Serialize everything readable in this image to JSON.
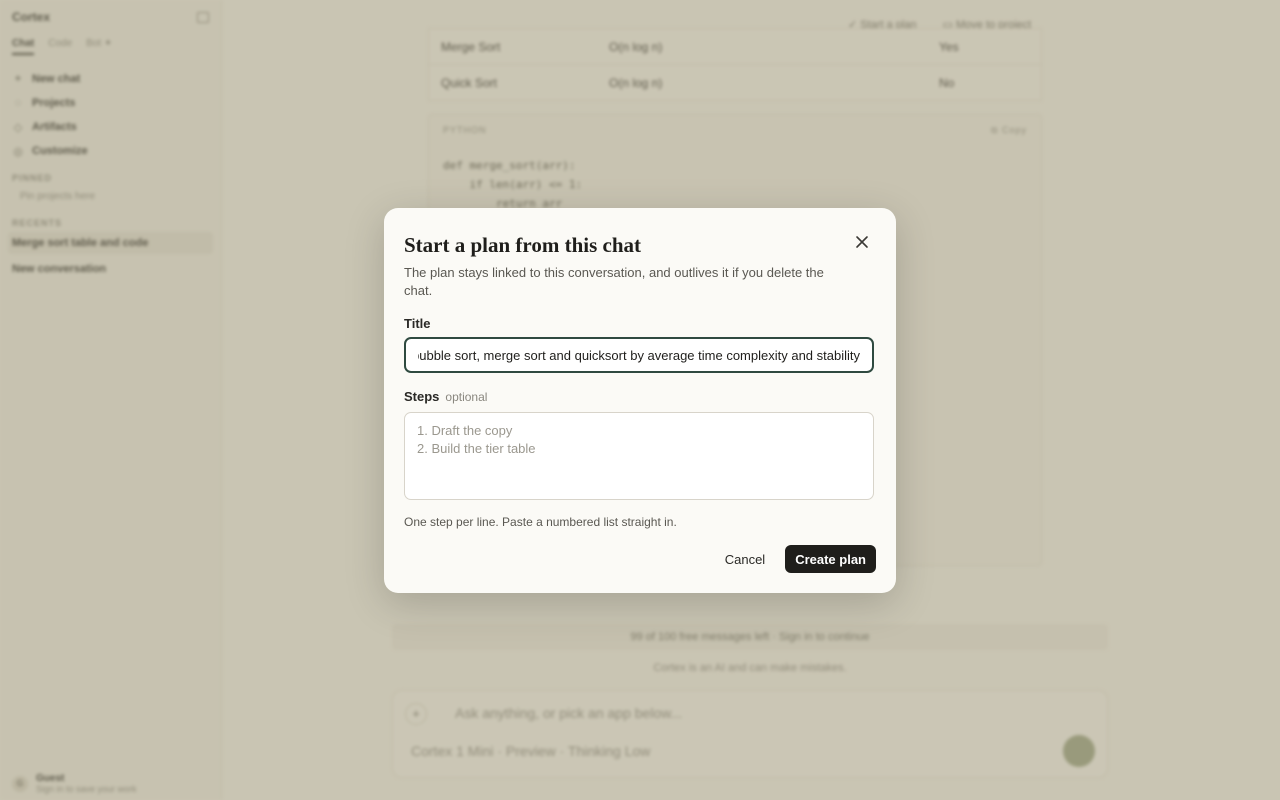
{
  "sidebar": {
    "brand": "Cortex",
    "tabs": [
      {
        "label": "Chat",
        "active": true
      },
      {
        "label": "Code",
        "active": false
      },
      {
        "label": "Bot ✦",
        "active": false
      }
    ],
    "nav": [
      {
        "icon": "plus-icon",
        "glyph": "+",
        "label": "New chat"
      },
      {
        "icon": "chat-bubble-icon",
        "glyph": "◌",
        "label": "Projects"
      },
      {
        "icon": "artifact-icon",
        "glyph": "◇",
        "label": "Artifacts"
      },
      {
        "icon": "customize-icon",
        "glyph": "◎",
        "label": "Customize"
      }
    ],
    "pinned_heading": "PINNED",
    "pinned_hint": "Pin projects here",
    "recents_heading": "RECENTS",
    "recents": [
      {
        "label": "Merge sort table and code",
        "active": true
      },
      {
        "label": "New conversation",
        "active": false
      }
    ],
    "user": {
      "avatar": "G",
      "name": "Guest",
      "sub": "Sign in to save your work"
    }
  },
  "topbar": {
    "start_plan": "Start a plan",
    "move_to_project": "Move to project"
  },
  "content": {
    "table_rows": [
      [
        "Merge Sort",
        "O(n log n)",
        "Yes"
      ],
      [
        "Quick Sort",
        "O(n log n)",
        "No"
      ]
    ],
    "code_lang": "PYTHON",
    "copy_label": "Copy",
    "code": "def merge_sort(arr):\n    if len(arr) <= 1:\n        return arr",
    "notice": "99 of 100 free messages left · Sign in to continue",
    "disclaimer": "Cortex is an AI and can make mistakes.",
    "composer_placeholder": "Ask anything, or pick an app below...",
    "model_label": "Cortex 1 Mini · Preview · Thinking Low"
  },
  "modal": {
    "title": "Start a plan from this chat",
    "description": "The plan stays linked to this conversation, and outlives it if you delete the chat.",
    "title_label": "Title",
    "title_value": "Compare bubble sort, merge sort and quicksort by average time complexity and stability",
    "steps_label": "Steps",
    "steps_optional": "optional",
    "steps_placeholder": "1. Draft the copy\n2. Build the tier table",
    "hint": "One step per line. Paste a numbered list straight in.",
    "cancel_label": "Cancel",
    "create_label": "Create plan"
  },
  "colors": {
    "accent": "#2f4a40",
    "primary_button": "#1f1e1b"
  }
}
